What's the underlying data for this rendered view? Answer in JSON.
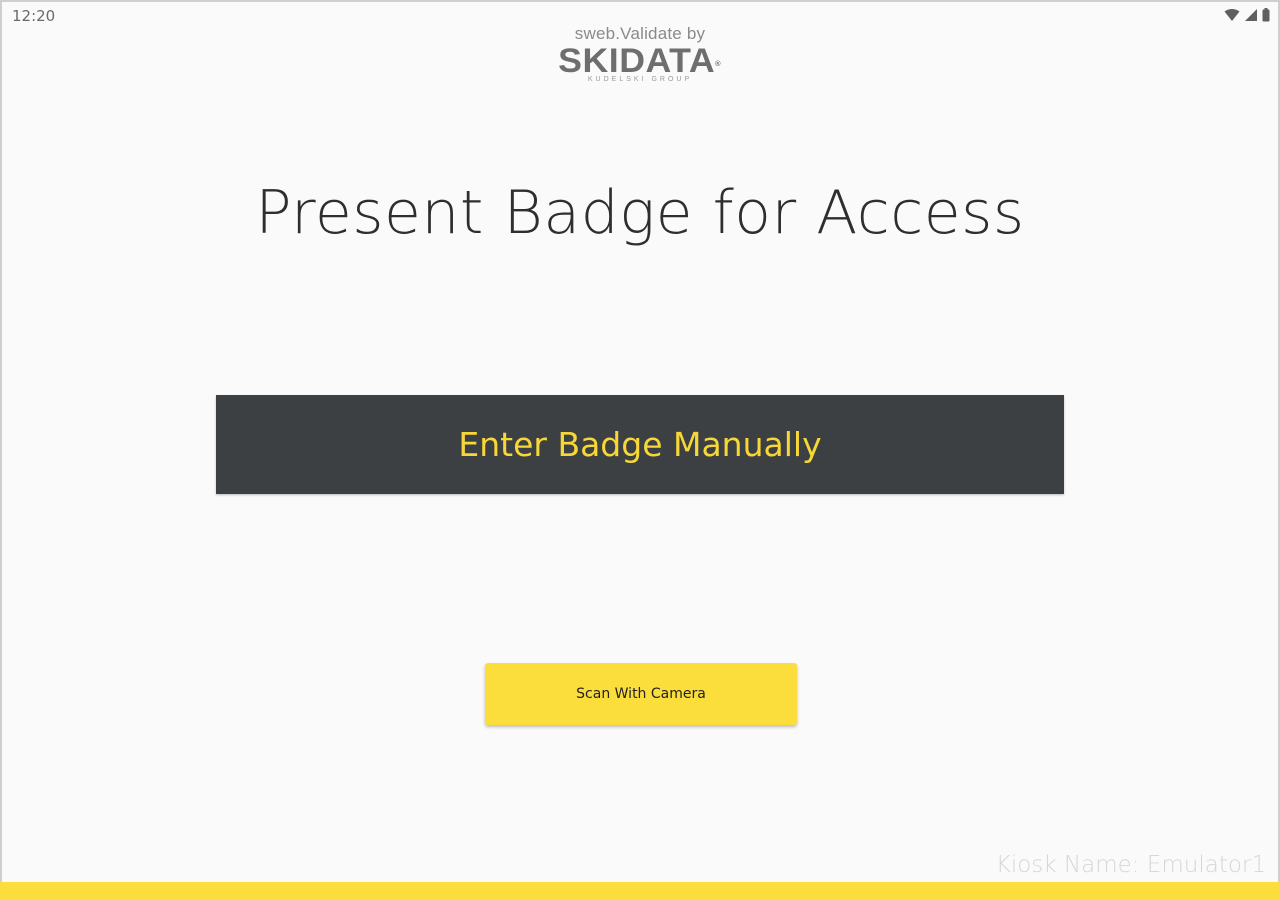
{
  "status_bar": {
    "time": "12:20",
    "icons": [
      "wifi-icon",
      "signal-icon",
      "battery-icon"
    ]
  },
  "logo": {
    "caption": "sweb.Validate by",
    "brand": "SKIDATA",
    "tagline": "KUDELSKI GROUP"
  },
  "main": {
    "title": "Present Badge for Access",
    "manual_button_label": "Enter Badge Manually",
    "camera_button_label": "Scan With Camera"
  },
  "footer": {
    "kiosk_name": "Kiosk Name: Emulator1"
  },
  "colors": {
    "accent_yellow": "#fbdd3b",
    "dark_button": "#3d4043",
    "dark_button_text": "#f7d737",
    "background": "#fafafa"
  }
}
